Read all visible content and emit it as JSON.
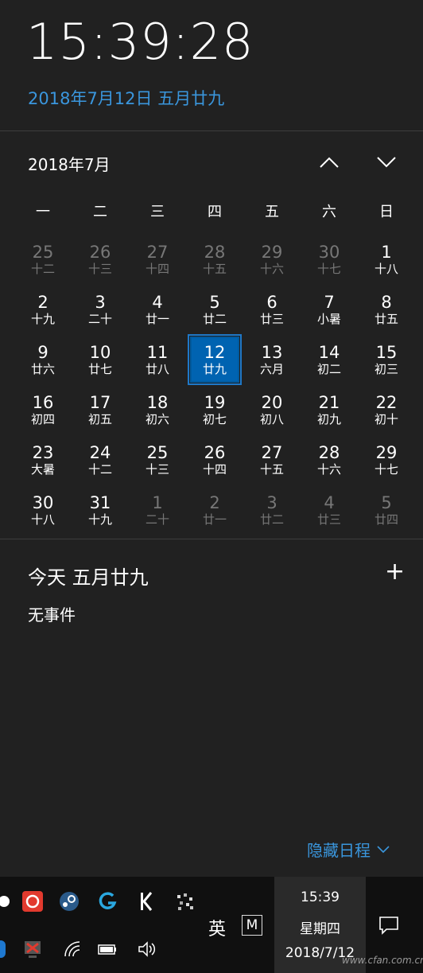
{
  "header": {
    "time": "15:39:28",
    "date_line": "2018年7月12日 五月廿九"
  },
  "calendar": {
    "month_title": "2018年7月",
    "weekdays": [
      "一",
      "二",
      "三",
      "四",
      "五",
      "六",
      "日"
    ],
    "weeks": [
      [
        {
          "n": "25",
          "l": "十二",
          "other": true
        },
        {
          "n": "26",
          "l": "十三",
          "other": true
        },
        {
          "n": "27",
          "l": "十四",
          "other": true
        },
        {
          "n": "28",
          "l": "十五",
          "other": true
        },
        {
          "n": "29",
          "l": "十六",
          "other": true
        },
        {
          "n": "30",
          "l": "十七",
          "other": true
        },
        {
          "n": "1",
          "l": "十八"
        }
      ],
      [
        {
          "n": "2",
          "l": "十九"
        },
        {
          "n": "3",
          "l": "二十"
        },
        {
          "n": "4",
          "l": "廿一"
        },
        {
          "n": "5",
          "l": "廿二"
        },
        {
          "n": "6",
          "l": "廿三"
        },
        {
          "n": "7",
          "l": "小暑"
        },
        {
          "n": "8",
          "l": "廿五"
        }
      ],
      [
        {
          "n": "9",
          "l": "廿六"
        },
        {
          "n": "10",
          "l": "廿七"
        },
        {
          "n": "11",
          "l": "廿八"
        },
        {
          "n": "12",
          "l": "廿九",
          "today": true
        },
        {
          "n": "13",
          "l": "六月"
        },
        {
          "n": "14",
          "l": "初二"
        },
        {
          "n": "15",
          "l": "初三"
        }
      ],
      [
        {
          "n": "16",
          "l": "初四"
        },
        {
          "n": "17",
          "l": "初五"
        },
        {
          "n": "18",
          "l": "初六"
        },
        {
          "n": "19",
          "l": "初七"
        },
        {
          "n": "20",
          "l": "初八"
        },
        {
          "n": "21",
          "l": "初九"
        },
        {
          "n": "22",
          "l": "初十"
        }
      ],
      [
        {
          "n": "23",
          "l": "大暑"
        },
        {
          "n": "24",
          "l": "十二"
        },
        {
          "n": "25",
          "l": "十三"
        },
        {
          "n": "26",
          "l": "十四"
        },
        {
          "n": "27",
          "l": "十五"
        },
        {
          "n": "28",
          "l": "十六"
        },
        {
          "n": "29",
          "l": "十七"
        }
      ],
      [
        {
          "n": "30",
          "l": "十八"
        },
        {
          "n": "31",
          "l": "十九"
        },
        {
          "n": "1",
          "l": "二十",
          "other": true
        },
        {
          "n": "2",
          "l": "廿一",
          "other": true
        },
        {
          "n": "3",
          "l": "廿二",
          "other": true
        },
        {
          "n": "4",
          "l": "廿三",
          "other": true
        },
        {
          "n": "5",
          "l": "廿四",
          "other": true
        }
      ]
    ]
  },
  "agenda": {
    "title": "今天 五月廿九",
    "add_label": "+",
    "no_events": "无事件",
    "hide_label": "隐藏日程"
  },
  "taskbar": {
    "time": "15:39",
    "weekday": "星期四",
    "date": "2018/7/12",
    "ime_label": "英",
    "m_label": "M"
  },
  "watermark": "www.cfan.com.cn",
  "colors": {
    "accent": "#3a96dd",
    "today_bg": "#0063b1",
    "bg": "#212121"
  },
  "icons": [
    "netease-music-icon",
    "steam-icon",
    "logitech-g-icon",
    "k-app-icon",
    "pixel-app-icon",
    "network-icon",
    "wifi-icon",
    "battery-icon",
    "volume-icon",
    "action-center-icon"
  ]
}
